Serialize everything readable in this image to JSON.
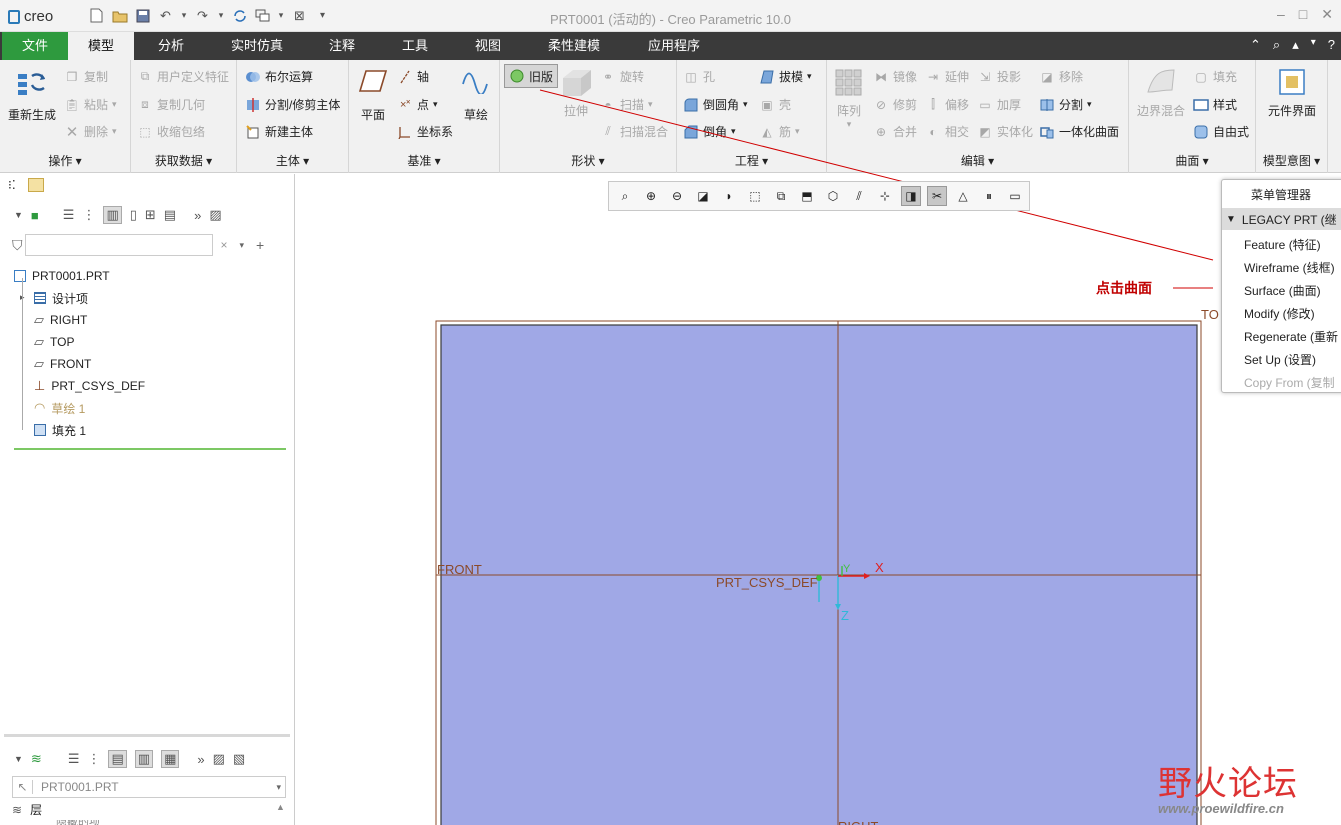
{
  "titlebar": {
    "app_logo": "creo",
    "window_title": "PRT0001 (活动的) - Creo Parametric 10.0"
  },
  "tabs": [
    "文件",
    "模型",
    "分析",
    "实时仿真",
    "注释",
    "工具",
    "视图",
    "柔性建模",
    "应用程序"
  ],
  "ribbon": {
    "operations": {
      "label": "操作",
      "regen": "重新生成",
      "copy": "复制",
      "paste": "粘贴",
      "delete": "删除"
    },
    "getdata": {
      "label": "获取数据",
      "udf": "用户定义特征",
      "copygeom": "复制几何",
      "shrinkwrap": "收缩包络"
    },
    "body": {
      "label": "主体",
      "boolean": "布尔运算",
      "split": "分割/修剪主体",
      "newbody": "新建主体"
    },
    "datum": {
      "label": "基准",
      "plane": "平面",
      "axis": "轴",
      "point": "点",
      "csys": "坐标系",
      "sketch": "草绘"
    },
    "shapes": {
      "label": "形状",
      "legacy": "旧版",
      "extrude": "拉伸",
      "revolve": "旋转",
      "sweep": "扫描",
      "swept_blend": "扫描混合"
    },
    "engineering": {
      "label": "工程",
      "hole": "孔",
      "round": "倒圆角",
      "chamfer": "倒角",
      "draft": "拔模",
      "shell": "壳",
      "rib": "筋"
    },
    "editing": {
      "label": "编辑",
      "pattern": "阵列",
      "mirror": "镜像",
      "extend": "延伸",
      "project": "投影",
      "trim": "修剪",
      "offset": "偏移",
      "thicken": "加厚",
      "merge": "合并",
      "intersect": "相交",
      "solidify": "实体化",
      "remove": "移除",
      "split": "分割",
      "unify": "一体化曲面"
    },
    "surfaces": {
      "label": "曲面",
      "boundary": "边界混合",
      "fill": "填充",
      "style": "样式",
      "freestyle": "自由式"
    },
    "intent": {
      "label": "模型意图",
      "component_interface": "元件界面"
    }
  },
  "tree": {
    "root": "PRT0001.PRT",
    "items": [
      "设计项",
      "RIGHT",
      "TOP",
      "FRONT",
      "PRT_CSYS_DEF",
      "草绘 1",
      "填充 1"
    ]
  },
  "layer_panel": {
    "model": "PRT0001.PRT",
    "layer_label": "层",
    "layer_sub": "隐藏的项"
  },
  "viewport": {
    "label_top": "TOP",
    "label_front": "FRONT",
    "label_right": "RIGHT",
    "csys_label": "PRT_CSYS_DEF",
    "x": "X",
    "y": "Y",
    "z": "Z"
  },
  "menu_manager": {
    "title": "菜单管理器",
    "header": "LEGACY PRT (继",
    "items": [
      "Feature (特征)",
      "Wireframe (线框)",
      "Surface (曲面)",
      "Modify (修改)",
      "Regenerate (重新",
      "Set Up (设置)",
      "Copy From (复制"
    ]
  },
  "annotation": "点击曲面",
  "watermark": {
    "name": "野火论坛",
    "url": "www.proewildfire.cn"
  },
  "colors": {
    "file_tab": "#2e9a3e",
    "tabbar": "#3a3a3a",
    "surface": "#a0a8e6",
    "datum": "#8b4a2a",
    "annotation": "#c00000"
  }
}
